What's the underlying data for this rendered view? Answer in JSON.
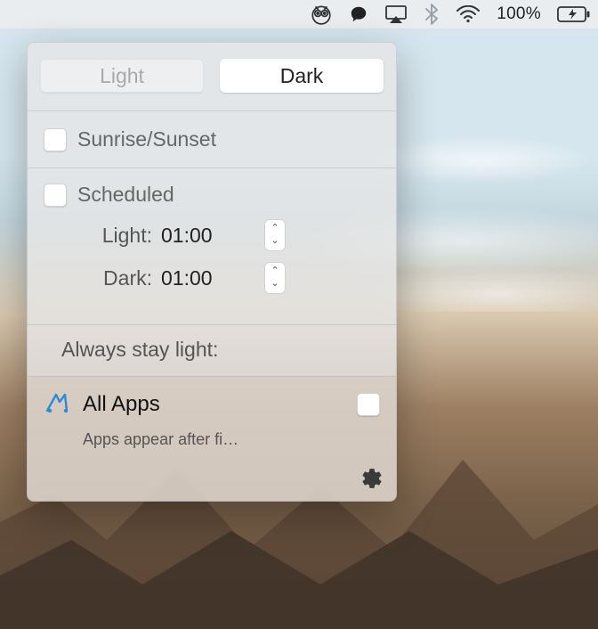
{
  "menubar": {
    "battery_percent": "100%"
  },
  "popover": {
    "seg": {
      "light_label": "Light",
      "dark_label": "Dark",
      "active": "dark"
    },
    "sunrise_label": "Sunrise/Sunset",
    "scheduled": {
      "label": "Scheduled",
      "light_label": "Light:",
      "light_time": "01:00",
      "dark_label": "Dark:",
      "dark_time": "01:00"
    },
    "stay_light_label": "Always stay light:",
    "apps": {
      "all_label": "All Apps",
      "hint": "Apps appear after fi…"
    }
  }
}
